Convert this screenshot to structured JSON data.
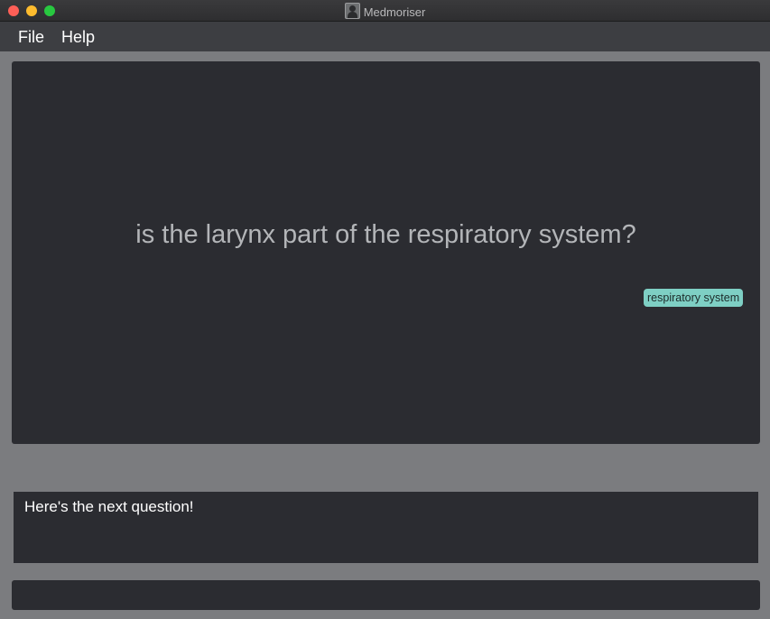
{
  "window": {
    "title": "Medmoriser"
  },
  "menu": {
    "items": [
      {
        "label": "File"
      },
      {
        "label": "Help"
      }
    ]
  },
  "card": {
    "question": "is the larynx part of the respiratory system?",
    "tags": [
      "respiratory system"
    ]
  },
  "result": {
    "message": "Here's the next question!"
  },
  "command": {
    "value": ""
  },
  "colors": {
    "background": "#7b7c7f",
    "panel": "#2b2c31",
    "menubar": "#3d3e42",
    "tag": "#7ecfc4",
    "question_text": "#b3b5b8"
  },
  "icons": [
    "window-close",
    "window-minimize",
    "window-maximize",
    "app-icon"
  ]
}
